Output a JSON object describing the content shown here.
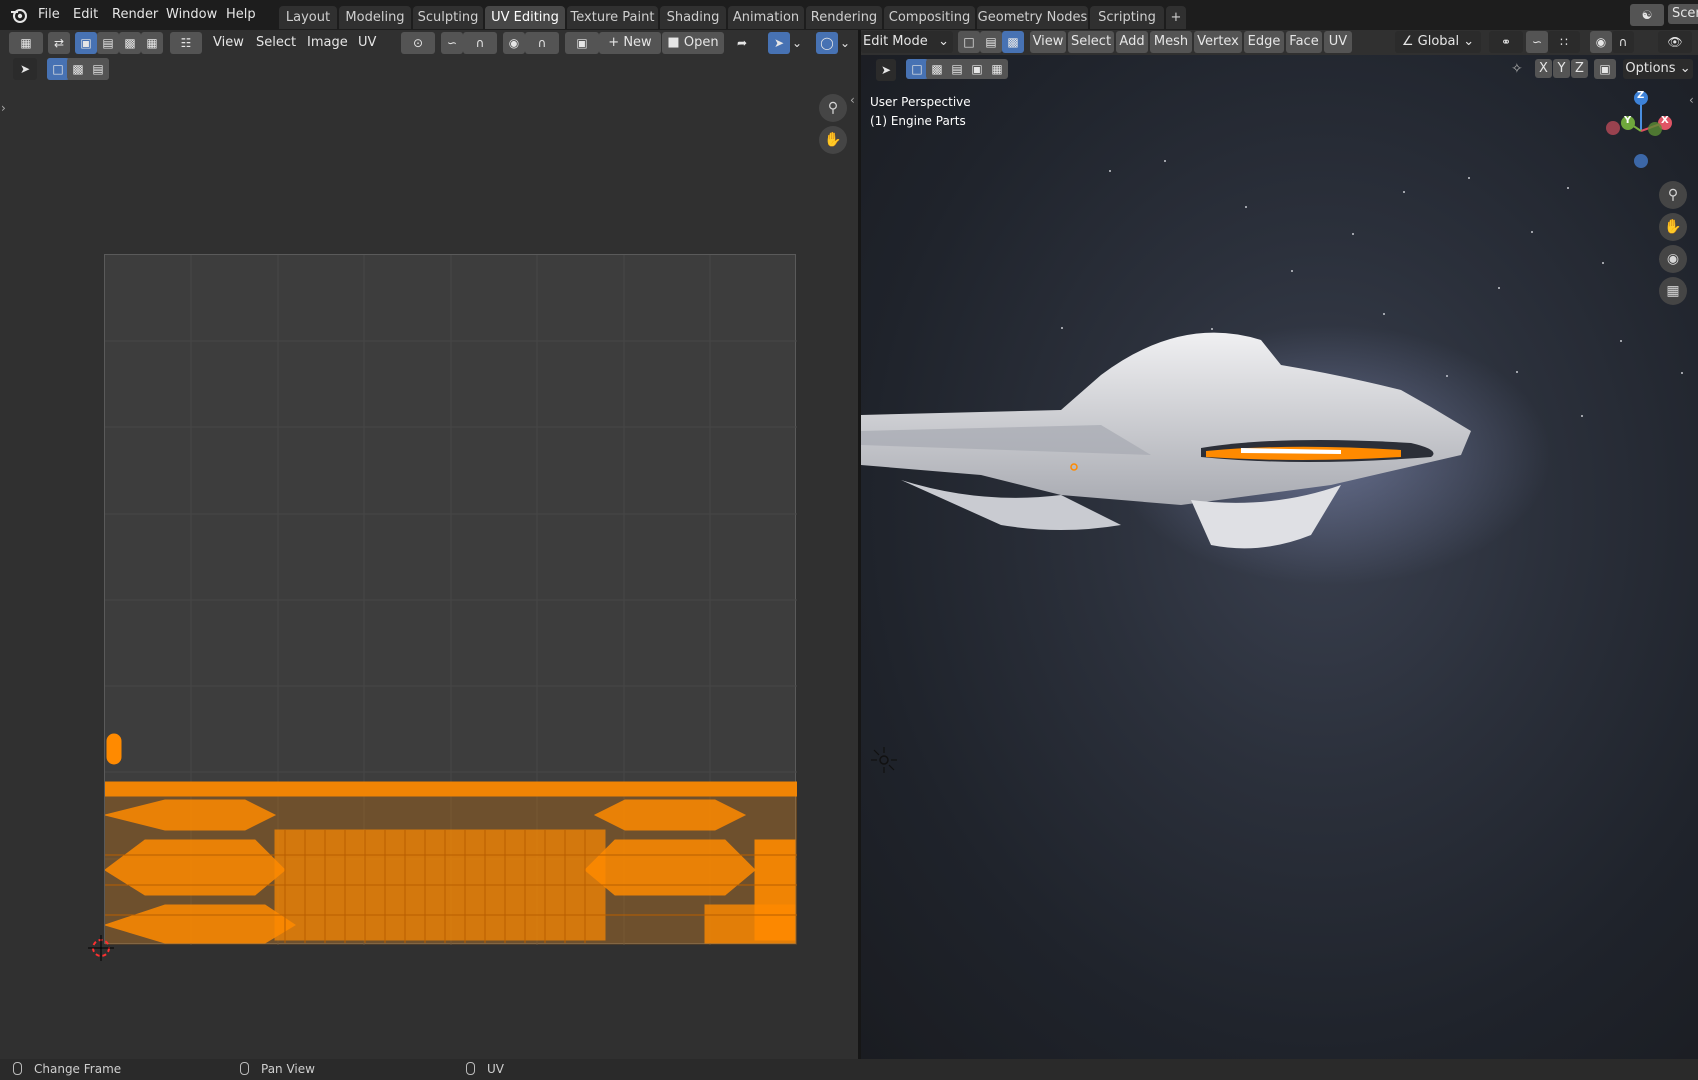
{
  "topbar": {
    "menus": [
      "File",
      "Edit",
      "Render",
      "Window",
      "Help"
    ],
    "workspaces": [
      "Layout",
      "Modeling",
      "Sculpting",
      "UV Editing",
      "Texture Paint",
      "Shading",
      "Animation",
      "Rendering",
      "Compositing",
      "Geometry Nodes",
      "Scripting"
    ],
    "active_workspace": "UV Editing",
    "add_tab": "+",
    "scene_label": "Scen"
  },
  "uv_editor": {
    "menus": [
      "View",
      "Select",
      "Image",
      "UV"
    ],
    "new_label": "New",
    "open_label": "Open"
  },
  "viewport": {
    "mode": "Edit Mode",
    "menus": [
      "View",
      "Select",
      "Add",
      "Mesh",
      "Vertex",
      "Edge",
      "Face",
      "UV"
    ],
    "transform_orientation": "Global",
    "axes": [
      "X",
      "Y",
      "Z"
    ],
    "options_label": "Options",
    "perspective_text": "User Perspective",
    "object_text": "(1) Engine Parts",
    "gizmo": {
      "x": "X",
      "y": "Y",
      "z": "Z"
    }
  },
  "statusbar": {
    "items": [
      "Change Frame",
      "Pan View",
      "UV"
    ]
  },
  "colors": {
    "accent_blue": "#4772b3",
    "uv_orange": "#ff8a00",
    "header_bg": "#303030"
  }
}
